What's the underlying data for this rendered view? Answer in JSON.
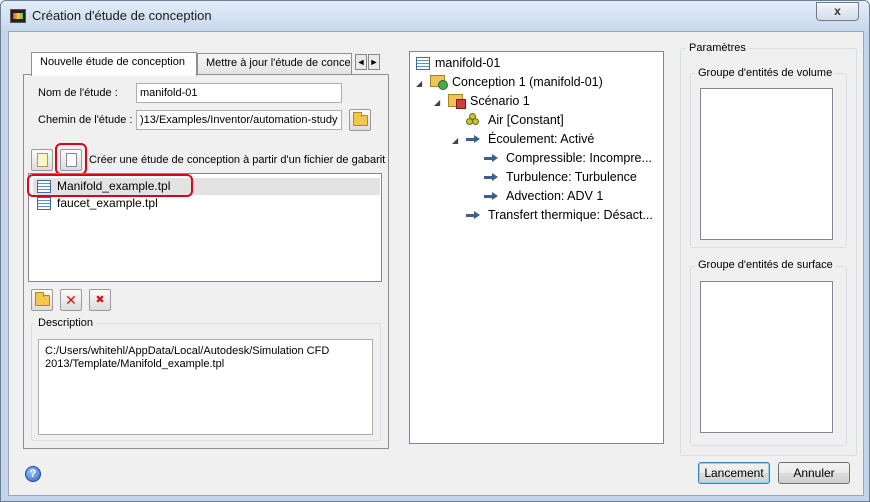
{
  "window": {
    "title": "Création d'étude de conception",
    "close_label": "x"
  },
  "tabs": [
    {
      "label": "Nouvelle étude de conception"
    },
    {
      "label": "Mettre à jour l'étude de conce"
    }
  ],
  "tab_scroll": {
    "left": "◄",
    "right": "►"
  },
  "form": {
    "name_label": "Nom de l'étude :",
    "name_value": "manifold-01",
    "path_label": "Chemin de l'étude :",
    "path_value": ")13/Examples/Inventor/automation-study",
    "template_caption": "Créer une étude de conception à partir d'un fichier de gabarit"
  },
  "templates": [
    {
      "label": "Manifold_example.tpl",
      "selected": true
    },
    {
      "label": "faucet_example.tpl",
      "selected": false
    }
  ],
  "description": {
    "title": "Description",
    "text": "C:/Users/whitehl/AppData/Local/Autodesk/Simulation CFD 2013/Template/Manifold_example.tpl"
  },
  "tree": {
    "root": "manifold-01",
    "design": "Conception 1 (manifold-01)",
    "scenario": "Scénario 1",
    "material": "Air [Constant]",
    "flow": "Écoulement: Activé",
    "compressible": "Compressible: Incompre...",
    "turbulence": "Turbulence: Turbulence",
    "advection": "Advection: ADV 1",
    "heat": "Transfert thermique: Désact..."
  },
  "params": {
    "title": "Paramètres",
    "volume_group": "Groupe d'entités de volume",
    "surface_group": "Groupe d'entités de surface"
  },
  "buttons": {
    "launch": "Lancement",
    "cancel": "Annuler",
    "help": "?"
  }
}
